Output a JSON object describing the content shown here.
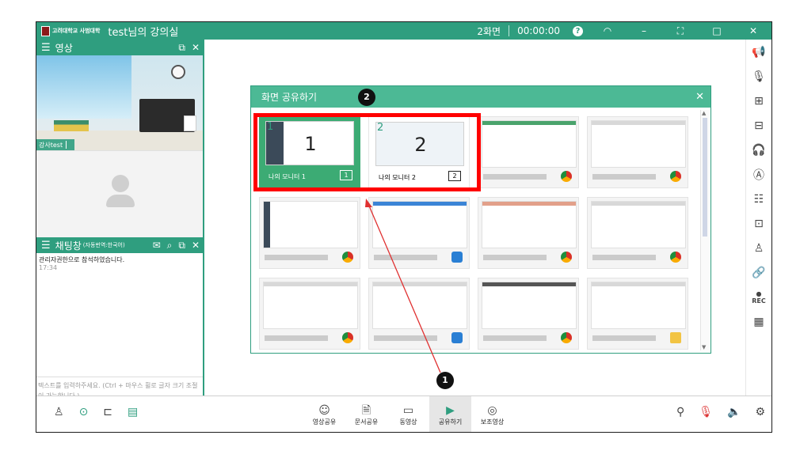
{
  "titlebar": {
    "logo_text": "고려대학교 사범대학",
    "title": "test님의 강의실",
    "screen_mode": "2화면",
    "timer": "00:00:00"
  },
  "video_panel": {
    "title": "영상",
    "presenter_tag": "강사test"
  },
  "chat_panel": {
    "title": "채팅창",
    "translate_note": "(자동번역:한국어)",
    "message": "관리자권한으로 참석하였습니다.",
    "message_time": "17:34",
    "input_placeholder": "텍스트를 입력하주세요. (Ctrl + 마우스 휠로 글자 크기 조절이 가능합니다.)"
  },
  "dialog": {
    "title": "화면 공유하기",
    "monitors": [
      {
        "number": "1",
        "label": "나의 모니터 1",
        "badge": "1"
      },
      {
        "number": "2",
        "label": "나의 모니터 2",
        "badge": "2"
      }
    ]
  },
  "bottombar": {
    "center": [
      {
        "label": "영상공유",
        "icon": "smiley-icon"
      },
      {
        "label": "문서공유",
        "icon": "document-icon"
      },
      {
        "label": "동영상",
        "icon": "video-icon"
      },
      {
        "label": "공유하기",
        "icon": "play-icon"
      },
      {
        "label": "보조영상",
        "icon": "camera-icon"
      }
    ]
  },
  "rightbar": {
    "rec_label": "REC"
  },
  "callouts": {
    "one": "1",
    "two": "2"
  },
  "colors": {
    "brand": "#2f9e7f",
    "dialog_header": "#4cb995",
    "highlight": "#ff0000"
  }
}
